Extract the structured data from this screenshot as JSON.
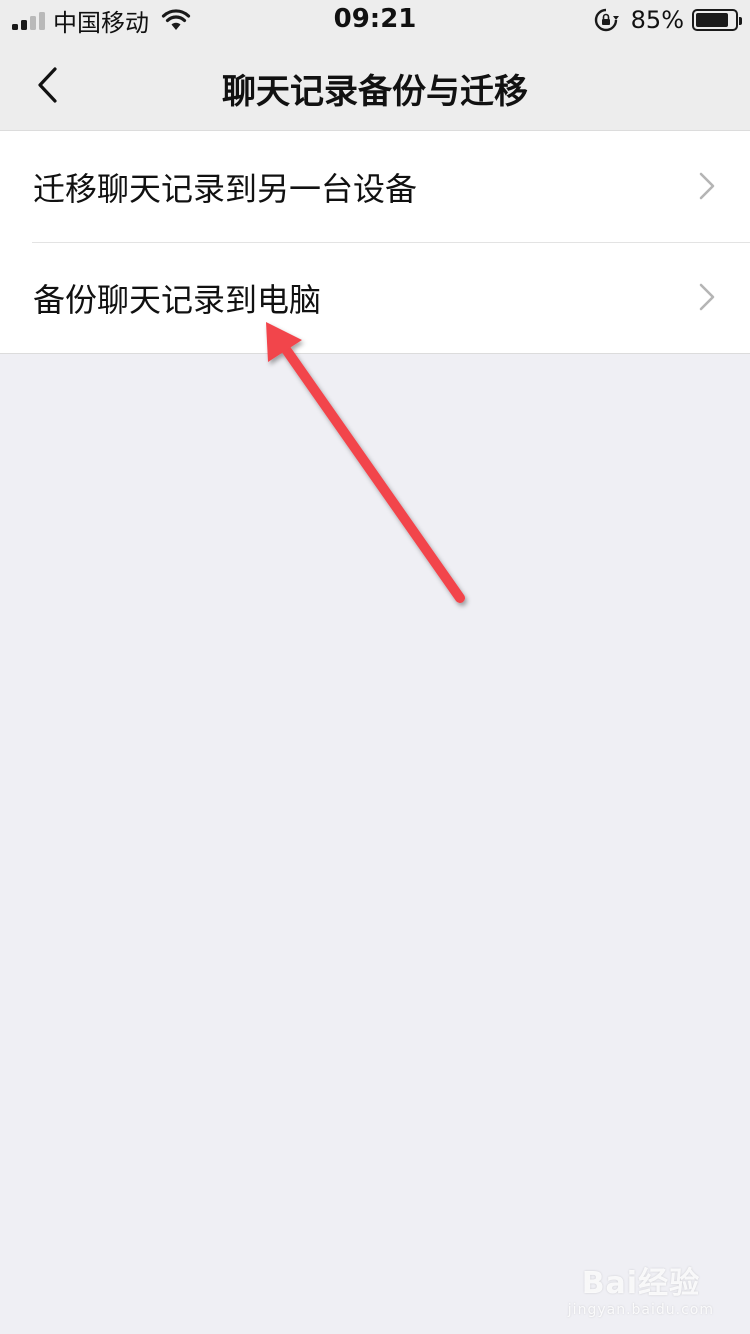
{
  "status_bar": {
    "carrier": "中国移动",
    "time": "09:21",
    "battery_percent_text": "85%",
    "battery_level": 0.85,
    "signal_bars_active": 2,
    "signal_bars_total": 4
  },
  "nav": {
    "title": "聊天记录备份与迁移"
  },
  "list": {
    "items": [
      {
        "label": "迁移聊天记录到另一台设备"
      },
      {
        "label": "备份聊天记录到电脑"
      }
    ]
  },
  "annotation": {
    "arrow_color": "#f2444c"
  },
  "watermark": {
    "main": "Bai经验",
    "sub": "jingyan.baidu.com"
  },
  "colors": {
    "background": "#efeff4",
    "header": "#ededed",
    "row": "#ffffff"
  }
}
